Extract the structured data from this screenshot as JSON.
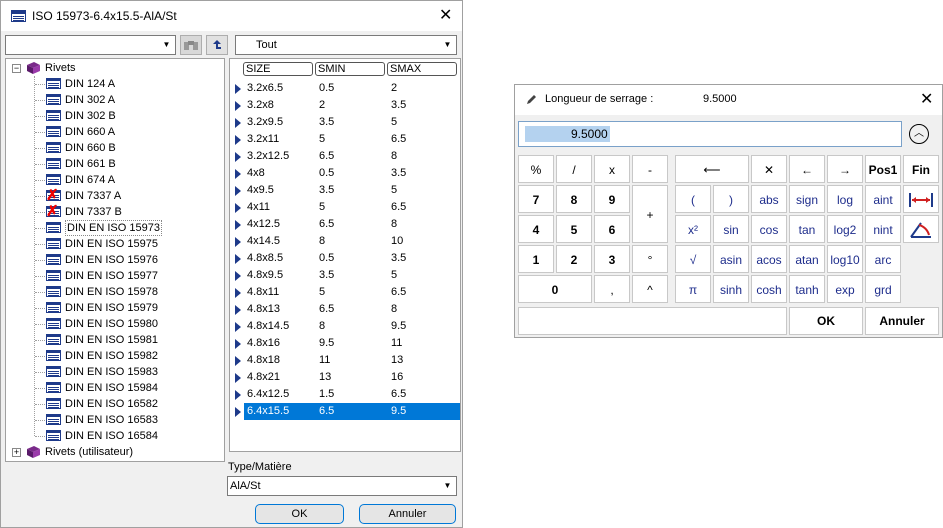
{
  "dialog1": {
    "title": "ISO 15973-6.4x15.5-AlA/St",
    "search_combo_value": "",
    "filter_combo_value": "Tout",
    "tree": {
      "root_label": "Rivets",
      "items": [
        "DIN 124 A",
        "DIN 302 A",
        "DIN 302 B",
        "DIN 660 A",
        "DIN 660 B",
        "DIN 661 B",
        "DIN 674 A",
        "DIN 7337 A",
        "DIN 7337 B",
        "DIN EN ISO 15973",
        "DIN EN ISO 15975",
        "DIN EN ISO 15976",
        "DIN EN ISO 15977",
        "DIN EN ISO 15978",
        "DIN EN ISO 15979",
        "DIN EN ISO 15980",
        "DIN EN ISO 15981",
        "DIN EN ISO 15982",
        "DIN EN ISO 15983",
        "DIN EN ISO 15984",
        "DIN EN ISO 16582",
        "DIN EN ISO 16583",
        "DIN EN ISO 16584"
      ],
      "crossed_items": [
        "DIN 7337 A",
        "DIN 7337 B"
      ],
      "selected_item": "DIN EN ISO 15973",
      "user_root_label": "Rivets (utilisateur)"
    },
    "grid": {
      "columns": [
        "SIZE",
        "SMIN",
        "SMAX"
      ],
      "rows": [
        [
          "3.2x6.5",
          "0.5",
          "2"
        ],
        [
          "3.2x8",
          "2",
          "3.5"
        ],
        [
          "3.2x9.5",
          "3.5",
          "5"
        ],
        [
          "3.2x11",
          "5",
          "6.5"
        ],
        [
          "3.2x12.5",
          "6.5",
          "8"
        ],
        [
          "4x8",
          "0.5",
          "3.5"
        ],
        [
          "4x9.5",
          "3.5",
          "5"
        ],
        [
          "4x11",
          "5",
          "6.5"
        ],
        [
          "4x12.5",
          "6.5",
          "8"
        ],
        [
          "4x14.5",
          "8",
          "10"
        ],
        [
          "4.8x8.5",
          "0.5",
          "3.5"
        ],
        [
          "4.8x9.5",
          "3.5",
          "5"
        ],
        [
          "4.8x11",
          "5",
          "6.5"
        ],
        [
          "4.8x13",
          "6.5",
          "8"
        ],
        [
          "4.8x14.5",
          "8",
          "9.5"
        ],
        [
          "4.8x16",
          "9.5",
          "11"
        ],
        [
          "4.8x18",
          "11",
          "13"
        ],
        [
          "4.8x21",
          "13",
          "16"
        ],
        [
          "6.4x12.5",
          "1.5",
          "6.5"
        ],
        [
          "6.4x15.5",
          "6.5",
          "9.5"
        ]
      ],
      "selected_row": 19
    },
    "type_label": "Type/Matière",
    "type_value": "AlA/St",
    "ok_label": "OK",
    "cancel_label": "Annuler"
  },
  "dialog2": {
    "title": "Longueur de serrage :",
    "title_value": "9.5000",
    "input_value": "9.5000",
    "collapse_icon": "chevron-up-circle-icon",
    "keys_left": {
      "r1": [
        "%",
        "/",
        "x",
        "-"
      ],
      "r2": [
        "7",
        "8",
        "9"
      ],
      "plus": "+",
      "r3": [
        "4",
        "5",
        "6"
      ],
      "r4": [
        "1",
        "2",
        "3",
        "°"
      ],
      "r5": [
        "0",
        ",",
        "^"
      ]
    },
    "keys_right": {
      "r1": [
        "⟵",
        "✕",
        "←",
        "→",
        "Pos1",
        "Fin"
      ],
      "r2": [
        "(",
        ")",
        "abs",
        "sign",
        "log",
        "aint"
      ],
      "r3": [
        "x²",
        "sin",
        "cos",
        "tan",
        "log2",
        "nint"
      ],
      "r4": [
        "√",
        "asin",
        "acos",
        "atan",
        "log10",
        "arc"
      ],
      "r5": [
        "π",
        "sinh",
        "cosh",
        "tanh",
        "exp",
        "grd"
      ]
    },
    "ok_label": "OK",
    "cancel_label": "Annuler"
  },
  "colors": {
    "accent": "#0078d7",
    "function_key_text": "#1e2d8c",
    "selection_highlight": "#b4d2ef"
  }
}
